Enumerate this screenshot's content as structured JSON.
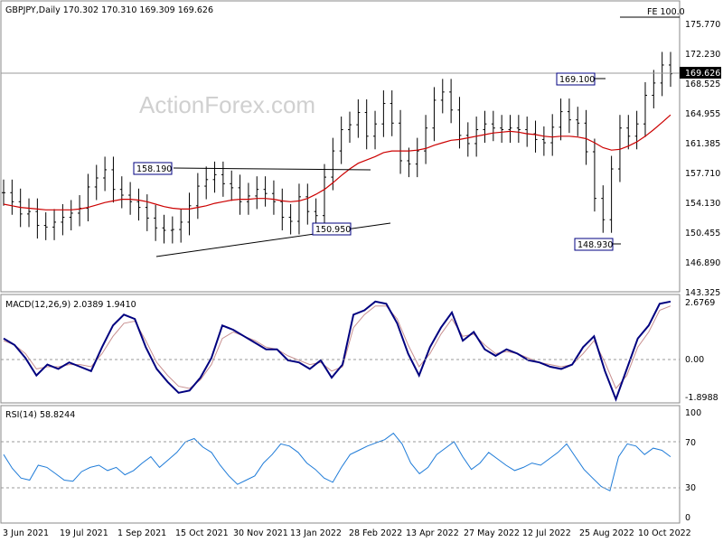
{
  "header": {
    "symbol_line": "GBPJPY,Daily  170.302 170.310 169.309 169.626",
    "watermark": "ActionForex.com"
  },
  "price_panel": {
    "fe_label": "FE 100.0",
    "last_price_label": "169.626",
    "y_ticks": [
      "175.770",
      "172.230",
      "168.525",
      "164.955",
      "161.385",
      "157.710",
      "154.130",
      "150.455",
      "146.890",
      "143.325"
    ],
    "annotations": [
      "158.190",
      "150.950",
      "169.100",
      "148.930"
    ]
  },
  "macd_panel": {
    "title": "MACD(12,26,9) 2.0389 1.9410",
    "y_ticks": [
      "2.6769",
      "0.00",
      "-1.8988"
    ]
  },
  "rsi_panel": {
    "title": "RSI(14) 58.8244",
    "y_ticks": [
      "100",
      "70",
      "30",
      "0"
    ]
  },
  "x_ticks": [
    "3 Jun 2021",
    "19 Jul 2021",
    "1 Sep 2021",
    "15 Oct 2021",
    "30 Nov 2021",
    "13 Jan 2022",
    "28 Feb 2022",
    "13 Apr 2022",
    "27 May 2022",
    "12 Jul 2022",
    "25 Aug 2022",
    "10 Oct 2022"
  ],
  "colors": {
    "price_bars": "#000000",
    "moving_average": "#cc0000",
    "macd_line": "#00007f",
    "signal_line": "#c89090",
    "rsi_line": "#1e7bd8",
    "grid_dashed": "#999999",
    "label_box_border": "#000080"
  },
  "chart_data": [
    {
      "type": "ohlc",
      "title": "GBPJPY,Daily",
      "last_ohlc": {
        "open": 170.302,
        "high": 170.31,
        "low": 169.309,
        "close": 169.626
      },
      "x_ticks": [
        "3 Jun 2021",
        "19 Jul 2021",
        "1 Sep 2021",
        "15 Oct 2021",
        "30 Nov 2021",
        "13 Jan 2022",
        "28 Feb 2022",
        "13 Apr 2022",
        "27 May 2022",
        "12 Jul 2022",
        "25 Aug 2022",
        "10 Oct 2022"
      ],
      "ylim": [
        143.325,
        178.2
      ],
      "close_approx": [
        155.1,
        154.0,
        152.5,
        152.8,
        151.1,
        150.9,
        151.5,
        152.1,
        152.6,
        153.2,
        155.8,
        156.9,
        157.9,
        155.5,
        154.8,
        154.0,
        153.3,
        152.0,
        150.8,
        150.5,
        150.6,
        151.5,
        153.5,
        155.9,
        156.7,
        157.3,
        156.2,
        155.7,
        154.0,
        154.7,
        155.5,
        155.0,
        154.0,
        152.1,
        151.6,
        154.6,
        152.8,
        152.3,
        157.0,
        160.2,
        162.8,
        163.4,
        164.9,
        162.0,
        163.5,
        166.0,
        163.6,
        159.0,
        158.6,
        160.2,
        163.0,
        166.4,
        167.4,
        165.2,
        162.1,
        161.1,
        162.8,
        163.5,
        163.0,
        162.8,
        163.0,
        162.8,
        162.3,
        161.6,
        161.2,
        163.1,
        165.0,
        164.0,
        163.6,
        160.1,
        154.4,
        151.8,
        158.0,
        163.0,
        162.0,
        163.5,
        167.0,
        168.5,
        170.7,
        169.63
      ],
      "ma_approx": [
        153.7,
        153.5,
        153.3,
        153.2,
        153.1,
        153.0,
        153.0,
        153.0,
        153.0,
        153.1,
        153.3,
        153.6,
        153.9,
        154.1,
        154.3,
        154.3,
        154.2,
        154.0,
        153.7,
        153.4,
        153.2,
        153.1,
        153.1,
        153.3,
        153.5,
        153.8,
        154.0,
        154.2,
        154.3,
        154.3,
        154.4,
        154.4,
        154.3,
        154.1,
        154.0,
        154.1,
        154.4,
        154.9,
        155.5,
        156.3,
        157.2,
        158.0,
        158.7,
        159.1,
        159.5,
        160.0,
        160.2,
        160.2,
        160.2,
        160.3,
        160.5,
        160.9,
        161.2,
        161.5,
        161.6,
        161.8,
        162.0,
        162.2,
        162.4,
        162.5,
        162.6,
        162.5,
        162.3,
        162.2,
        162.0,
        161.9,
        162.0,
        162.0,
        161.9,
        161.7,
        161.2,
        160.6,
        160.3,
        160.4,
        160.8,
        161.3,
        162.0,
        162.8,
        163.7,
        164.6
      ],
      "trendlines": [
        {
          "from": [
            "Jun 2021",
            158.19
          ],
          "to": [
            "Feb 2022",
            157.8
          ]
        },
        {
          "from": [
            "Aug 2021",
            147.8
          ],
          "to": [
            "Mar 2022",
            151.1
          ]
        }
      ],
      "labels": [
        158.19,
        150.95,
        169.1,
        148.93
      ],
      "fe_level": {
        "label": "FE 100.0",
        "value": 176.8
      }
    },
    {
      "type": "line",
      "title": "MACD(12,26,9)",
      "series": [
        {
          "name": "MACD",
          "values_approx": [
            0.9,
            0.6,
            0.0,
            -0.8,
            -0.3,
            -0.5,
            -0.2,
            -0.4,
            -0.6,
            0.5,
            1.5,
            2.0,
            1.8,
            0.5,
            -0.5,
            -1.1,
            -1.6,
            -1.5,
            -0.9,
            0.0,
            1.5,
            1.3,
            1.0,
            0.7,
            0.4,
            0.4,
            -0.1,
            -0.2,
            -0.5,
            -0.1,
            -0.9,
            -0.3,
            2.0,
            2.2,
            2.6,
            2.5,
            1.6,
            0.2,
            -0.8,
            0.5,
            1.4,
            2.1,
            0.8,
            1.2,
            0.4,
            0.1,
            0.4,
            0.2,
            -0.1,
            -0.2,
            -0.4,
            -0.5,
            -0.3,
            0.5,
            1.0,
            -0.6,
            -1.9,
            -0.5,
            0.9,
            1.5,
            2.5,
            2.6
          ]
        },
        {
          "name": "Signal",
          "values_approx": [
            0.8,
            0.6,
            0.2,
            -0.5,
            -0.4,
            -0.4,
            -0.3,
            -0.3,
            -0.4,
            0.2,
            1.0,
            1.6,
            1.7,
            0.8,
            -0.2,
            -0.8,
            -1.3,
            -1.4,
            -1.0,
            -0.3,
            0.9,
            1.2,
            1.0,
            0.8,
            0.5,
            0.4,
            0.1,
            -0.1,
            -0.3,
            -0.2,
            -0.6,
            -0.4,
            1.4,
            2.0,
            2.4,
            2.4,
            1.8,
            0.6,
            -0.4,
            0.2,
            1.1,
            1.8,
            1.0,
            1.1,
            0.6,
            0.2,
            0.3,
            0.2,
            0.0,
            -0.2,
            -0.3,
            -0.4,
            -0.3,
            0.2,
            0.8,
            -0.2,
            -1.4,
            -0.8,
            0.5,
            1.2,
            2.2,
            2.4
          ]
        }
      ],
      "ylim": [
        -1.8988,
        2.6769
      ]
    },
    {
      "type": "line",
      "title": "RSI(14)",
      "series": [
        {
          "name": "RSI(14)",
          "values_approx": [
            60,
            47,
            38,
            36,
            50,
            48,
            42,
            36,
            35,
            44,
            48,
            50,
            45,
            48,
            41,
            45,
            52,
            58,
            48,
            55,
            62,
            72,
            75,
            67,
            62,
            50,
            40,
            32,
            36,
            40,
            52,
            60,
            70,
            68,
            62,
            52,
            46,
            38,
            34,
            48,
            60,
            64,
            68,
            71,
            74,
            80,
            70,
            52,
            42,
            48,
            60,
            66,
            72,
            58,
            46,
            52,
            62,
            56,
            50,
            45,
            48,
            52,
            50,
            56,
            62,
            70,
            58,
            46,
            38,
            30,
            26,
            58,
            70,
            68,
            60,
            66,
            64,
            58
          ]
        }
      ],
      "ylim": [
        0,
        100
      ],
      "levels": [
        70,
        30
      ]
    }
  ]
}
